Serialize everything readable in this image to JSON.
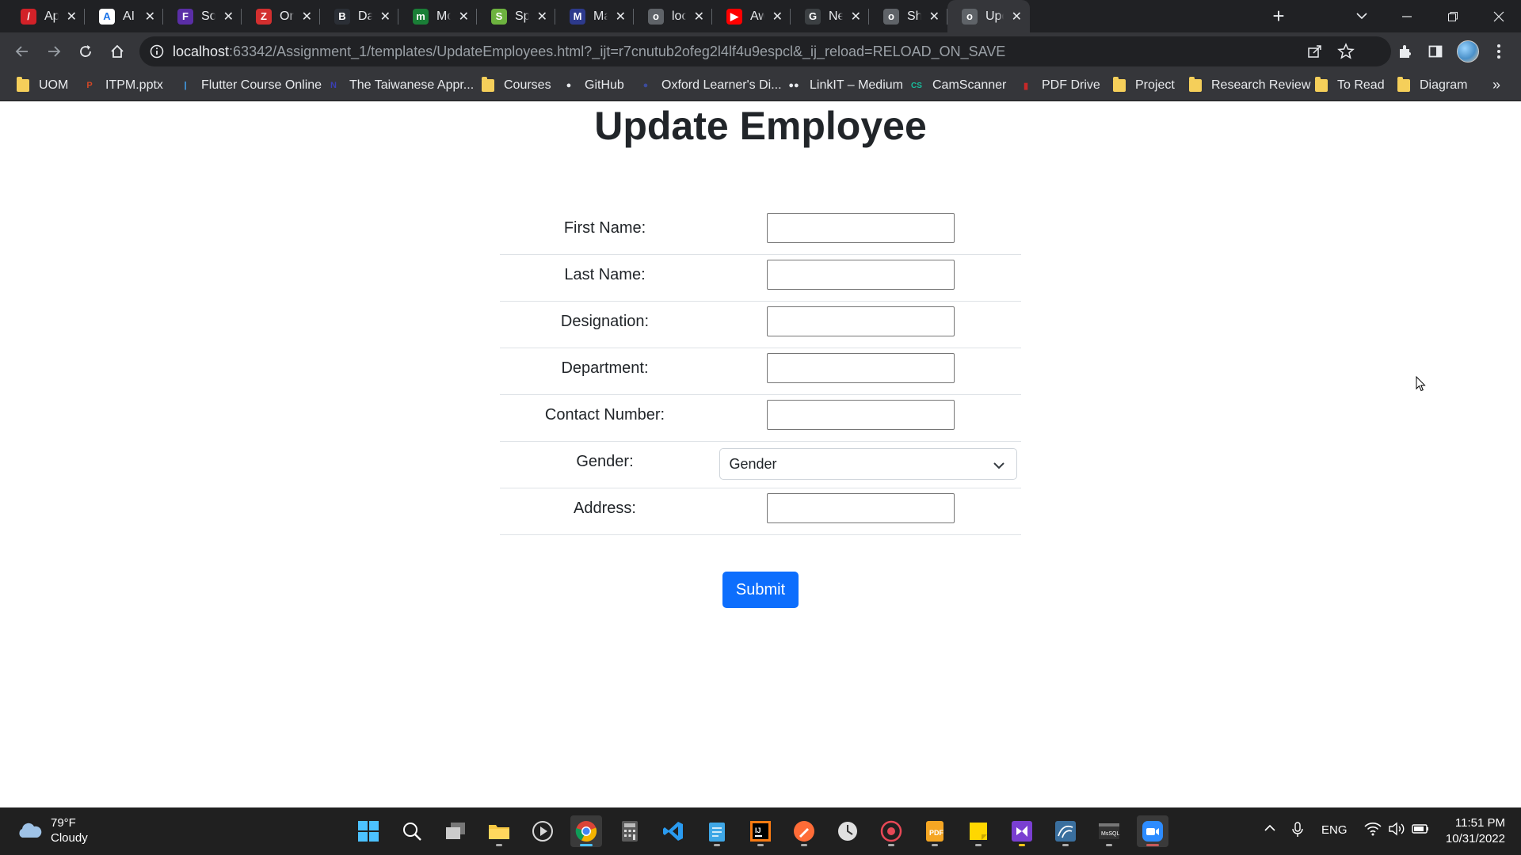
{
  "tabs": [
    {
      "title": "Apache",
      "favicon_color": "#d22128",
      "glyph": "/"
    },
    {
      "title": "AI Sea",
      "favicon_color": "#ffffff",
      "glyph": "A"
    },
    {
      "title": "Softw",
      "favicon_color": "#5a2ea6",
      "glyph": "F"
    },
    {
      "title": "Online",
      "favicon_color": "#d32f2f",
      "glyph": "Z"
    },
    {
      "title": "Dashb",
      "favicon_color": "#2b2f36",
      "glyph": "B"
    },
    {
      "title": "Most",
      "favicon_color": "#1a7f37",
      "glyph": "m"
    },
    {
      "title": "Spring",
      "favicon_color": "#6db33f",
      "glyph": "S"
    },
    {
      "title": "Maven",
      "favicon_color": "#2d3a8c",
      "glyph": "M"
    },
    {
      "title": "localh",
      "favicon_color": "#5f6368",
      "glyph": "o"
    },
    {
      "title": "Awath",
      "favicon_color": "#ff0000",
      "glyph": "▶"
    },
    {
      "title": "New T",
      "favicon_color": "#3c4043",
      "glyph": "G"
    },
    {
      "title": "Show",
      "favicon_color": "#5f6368",
      "glyph": "o"
    },
    {
      "title": "Updat",
      "favicon_color": "#5f6368",
      "glyph": "o"
    }
  ],
  "address_bar": {
    "host": "localhost",
    "rest": ":63342/Assignment_1/templates/UpdateEmployees.html?_ijt=r7cnutub2ofeg2l4lf4u9espcl&_ij_reload=RELOAD_ON_SAVE"
  },
  "bookmarks": [
    {
      "label": "UOM",
      "icon": "folder"
    },
    {
      "label": "ITPM.pptx",
      "icon": "pptx-icon"
    },
    {
      "label": "Flutter Course Online",
      "icon": "flutter-icon"
    },
    {
      "label": "The Taiwanese Appr...",
      "icon": "n-icon"
    },
    {
      "label": "Courses",
      "icon": "folder"
    },
    {
      "label": "GitHub",
      "icon": "github-icon"
    },
    {
      "label": "Oxford Learner's Di...",
      "icon": "oxford-icon"
    },
    {
      "label": "LinkIT – Medium",
      "icon": "medium-icon"
    },
    {
      "label": "CamScanner",
      "icon": "cs-icon"
    },
    {
      "label": "PDF Drive",
      "icon": "pdf-icon"
    },
    {
      "label": "Project",
      "icon": "folder"
    },
    {
      "label": "Research Review",
      "icon": "folder"
    },
    {
      "label": "To Read",
      "icon": "folder"
    },
    {
      "label": "Diagram",
      "icon": "folder"
    }
  ],
  "page": {
    "heading": "Update Employee",
    "fields": [
      {
        "label": "First Name:",
        "type": "text",
        "value": ""
      },
      {
        "label": "Last Name:",
        "type": "text",
        "value": ""
      },
      {
        "label": "Designation:",
        "type": "text",
        "value": ""
      },
      {
        "label": "Department:",
        "type": "text",
        "value": ""
      },
      {
        "label": "Contact Number:",
        "type": "text",
        "value": ""
      },
      {
        "label": "Gender:",
        "type": "select",
        "value": "Gender"
      },
      {
        "label": "Address:",
        "type": "text",
        "value": ""
      }
    ],
    "submit_label": "Submit"
  },
  "taskbar": {
    "weather": {
      "temp": "79°F",
      "condition": "Cloudy"
    },
    "language": "ENG",
    "time": "11:51 PM",
    "date": "10/31/2022"
  },
  "colors": {
    "primary": "#0d6efd",
    "tab_bg": "#202124",
    "toolbar_bg": "#35363a"
  }
}
